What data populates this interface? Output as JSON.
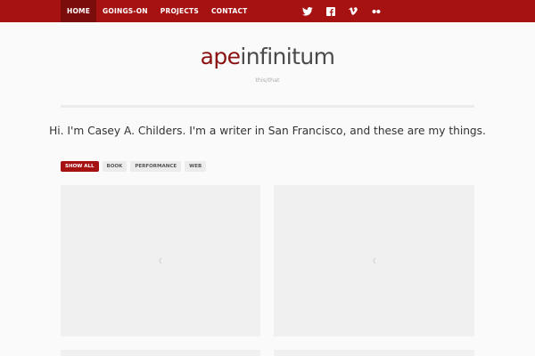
{
  "nav": {
    "items": [
      {
        "label": "HOME",
        "active": true
      },
      {
        "label": "GOINGS-ON",
        "active": false
      },
      {
        "label": "PROJECTS",
        "active": false
      },
      {
        "label": "CONTACT",
        "active": false
      }
    ]
  },
  "social": {
    "icons": [
      "twitter-icon",
      "facebook-icon",
      "vimeo-icon",
      "flickr-icon"
    ]
  },
  "site": {
    "logo_part1": "ape",
    "logo_part2": "infinitum",
    "tagline": "this/that"
  },
  "intro": {
    "text": "Hi. I'm Casey A. Childers. I'm a writer in San Francisco, and these are my things."
  },
  "filters": {
    "items": [
      {
        "label": "SHOW ALL",
        "active": true
      },
      {
        "label": "BOOK",
        "active": false
      },
      {
        "label": "PERFORMANCE",
        "active": false
      },
      {
        "label": "WEB",
        "active": false
      }
    ]
  },
  "colors": {
    "brand_red": "#a61212",
    "brand_red_dark": "#7c0d0d",
    "logo_red": "#8b1212",
    "background": "#fafafa",
    "card": "#f0f0f0"
  }
}
